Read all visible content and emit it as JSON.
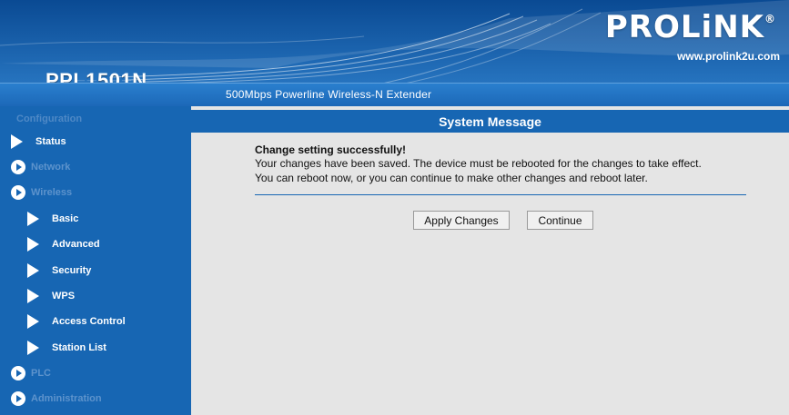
{
  "header": {
    "model": "PPL1501N",
    "logo": "PROLiNK",
    "logo_mark": "®",
    "website": "www.prolink2u.com",
    "tagline": "500Mbps Powerline Wireless-N Extender"
  },
  "sidebar": {
    "heading": "Configuration",
    "items": [
      {
        "label": "Status",
        "icon": "triangle-icon"
      },
      {
        "label": "Network",
        "icon": "circle-arrow-icon"
      },
      {
        "label": "Wireless",
        "icon": "circle-arrow-icon"
      },
      {
        "label": "Basic",
        "icon": "triangle-icon"
      },
      {
        "label": "Advanced",
        "icon": "triangle-icon"
      },
      {
        "label": "Security",
        "icon": "triangle-icon"
      },
      {
        "label": "WPS",
        "icon": "triangle-icon"
      },
      {
        "label": "Access Control",
        "icon": "triangle-icon"
      },
      {
        "label": "Station List",
        "icon": "triangle-icon"
      },
      {
        "label": "PLC",
        "icon": "circle-arrow-icon"
      },
      {
        "label": "Administration",
        "icon": "circle-arrow-icon"
      }
    ]
  },
  "main": {
    "title": "System Message",
    "message_title": "Change setting successfully!",
    "message_line1": "Your changes have been saved. The device must be rebooted for the changes to take effect.",
    "message_line2": "You can reboot now, or you can continue to make other changes and reboot later.",
    "apply_button": "Apply Changes",
    "continue_button": "Continue"
  },
  "colors": {
    "brand_blue": "#1766b3",
    "content_bg": "#e5e5e5",
    "dim_text": "#5d93cc"
  }
}
